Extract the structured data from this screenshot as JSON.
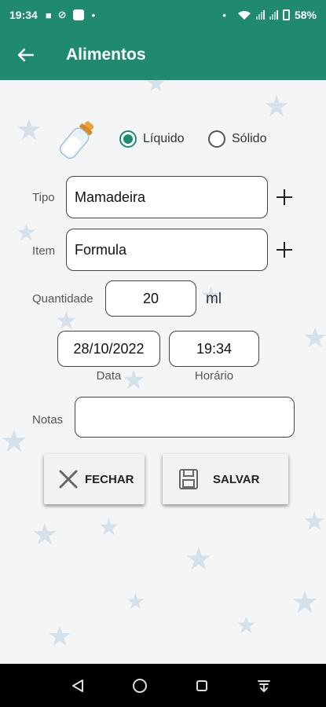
{
  "status_bar": {
    "time": "19:34",
    "battery": "58%",
    "icons": [
      "sim-icon",
      "no-sync-icon",
      "app-square-icon",
      "dot-icon",
      "dot-icon",
      "wifi-icon",
      "signal-icon",
      "signal-icon",
      "battery-icon"
    ]
  },
  "app_bar": {
    "title": "Alimentos",
    "back_icon": "arrow-left-icon",
    "background_color": "#1f8a70"
  },
  "form": {
    "food_type": {
      "options": [
        {
          "label": "Líquido",
          "selected": true
        },
        {
          "label": "Sólido",
          "selected": false
        }
      ],
      "icon": "baby-bottle-icon"
    },
    "tipo": {
      "label": "Tipo",
      "value": "Mamadeira"
    },
    "item": {
      "label": "Item",
      "value": "Formula"
    },
    "quantidade": {
      "label": "Quantidade",
      "value": "20",
      "unit": "ml"
    },
    "data": {
      "label": "Data",
      "value": "28/10/2022"
    },
    "horario": {
      "label": "Horário",
      "value": "19:34"
    },
    "notas": {
      "label": "Notas",
      "value": ""
    }
  },
  "buttons": {
    "close_label": "FECHAR",
    "save_label": "SALVAR"
  },
  "nav_bar": {
    "icons": [
      "back-triangle-icon",
      "home-circle-icon",
      "recents-square-icon",
      "keyboard-hide-icon"
    ]
  },
  "colors": {
    "accent": "#1f8a70",
    "background": "#f4f5f6",
    "star": "#d5e1ea"
  }
}
